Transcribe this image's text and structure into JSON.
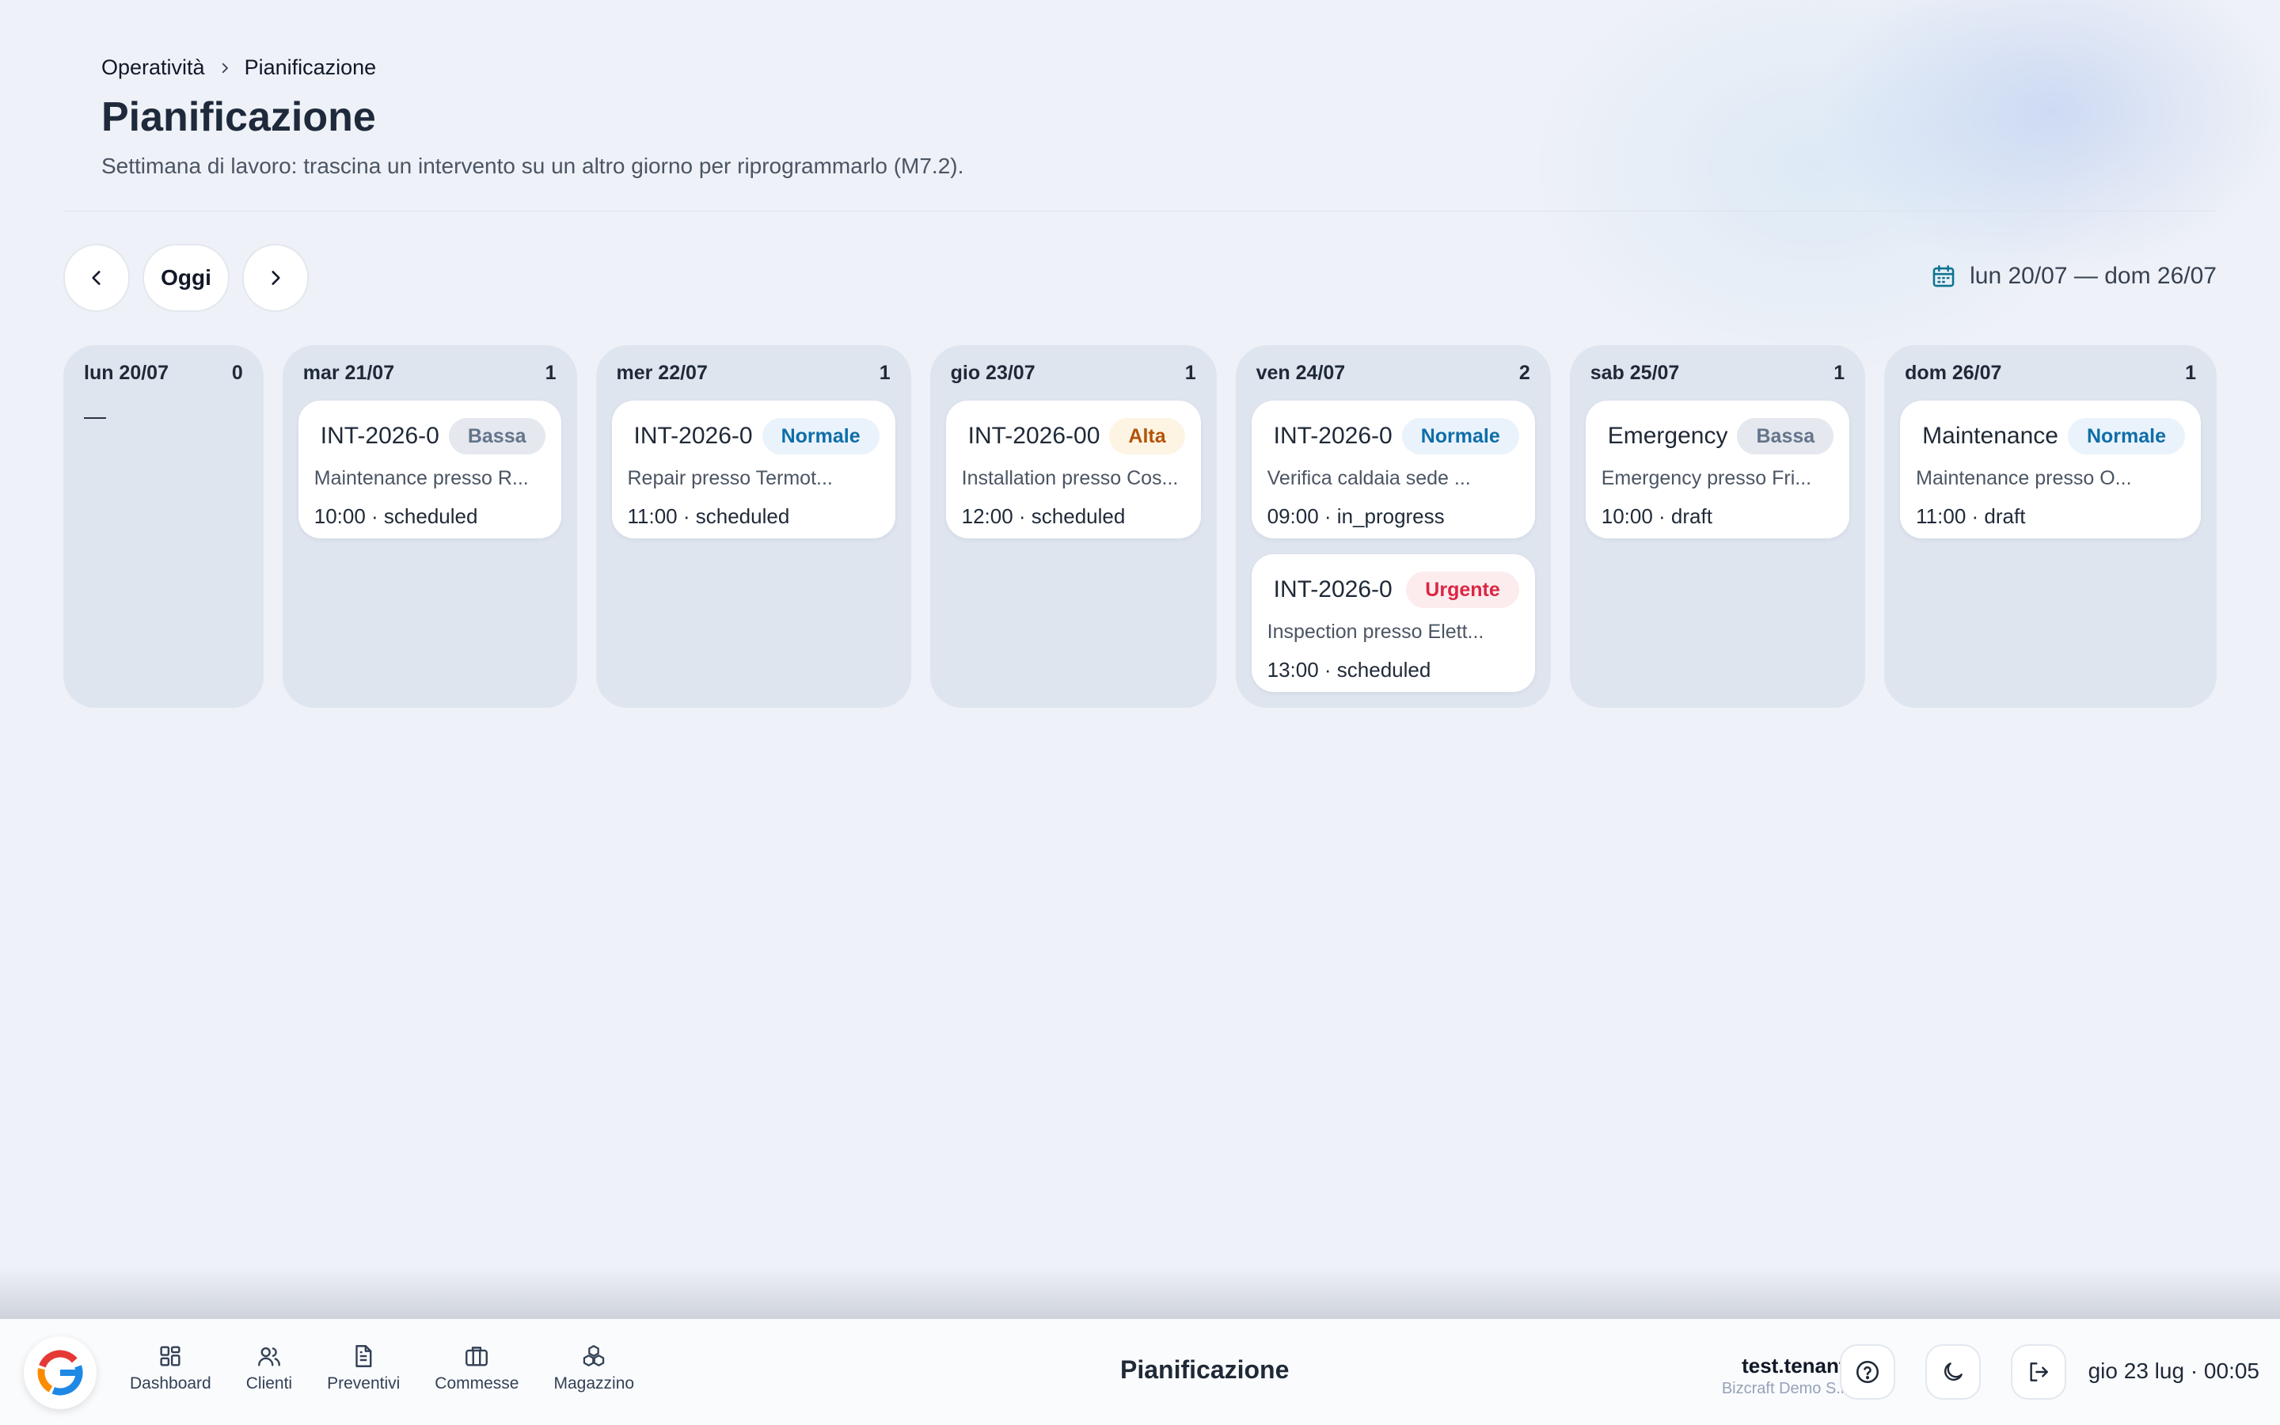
{
  "breadcrumb": {
    "parent": "Operatività",
    "current": "Pianificazione"
  },
  "page": {
    "title": "Pianificazione",
    "subtitle": "Settimana di lavoro: trascina un intervento su un altro giorno per riprogrammarlo (M7.2)."
  },
  "toolbar": {
    "today_label": "Oggi",
    "range_label": "lun 20/07 — dom 26/07"
  },
  "days": [
    {
      "label": "lun 20/07",
      "count": "0",
      "empty": "—"
    },
    {
      "label": "mar 21/07",
      "count": "1"
    },
    {
      "label": "mer 22/07",
      "count": "1"
    },
    {
      "label": "gio 23/07",
      "count": "1"
    },
    {
      "label": "ven 24/07",
      "count": "2"
    },
    {
      "label": "sab 25/07",
      "count": "1"
    },
    {
      "label": "dom 26/07",
      "count": "1"
    }
  ],
  "cards": {
    "mar_1": {
      "code": "INT-2026-0",
      "badge": "Bassa",
      "desc": "Maintenance presso R...",
      "meta": "10:00 · scheduled"
    },
    "mer_1": {
      "code": "INT-2026-0",
      "badge": "Normale",
      "desc": "Repair presso Termot...",
      "meta": "11:00 · scheduled"
    },
    "gio_1": {
      "code": "INT-2026-00",
      "badge": "Alta",
      "desc": "Installation presso Cos...",
      "meta": "12:00 · scheduled"
    },
    "ven_1": {
      "code": "INT-2026-0",
      "badge": "Normale",
      "desc": "Verifica caldaia sede ...",
      "meta": "09:00 · in_progress"
    },
    "ven_2": {
      "code": "INT-2026-0",
      "badge": "Urgente",
      "desc": "Inspection presso Elett...",
      "meta": "13:00 · scheduled"
    },
    "sab_1": {
      "code": "Emergency",
      "badge": "Bassa",
      "desc": "Emergency presso Fri...",
      "meta": "10:00 · draft"
    },
    "dom_1": {
      "code": "Maintenance",
      "badge": "Normale",
      "desc": "Maintenance presso O...",
      "meta": "11:00 · draft"
    }
  },
  "bottombar": {
    "tabs": [
      {
        "label": "Dashboard",
        "icon": "grid-icon"
      },
      {
        "label": "Clienti",
        "icon": "users-icon"
      },
      {
        "label": "Preventivi",
        "icon": "document-icon"
      },
      {
        "label": "Commesse",
        "icon": "briefcase-icon"
      },
      {
        "label": "Magazzino",
        "icon": "boxes-icon"
      }
    ],
    "title": "Pianificazione",
    "user_name": "test.tenant1",
    "user_org": "Bizcraft Demo S.r.l.",
    "clock": "gio 23 lug · 00:05"
  },
  "colors": {
    "accent": "#0e6ea8",
    "bassa": "#64748b",
    "normale": "#0e6ea8",
    "alta": "#b45309",
    "urgente": "#dc2643"
  }
}
